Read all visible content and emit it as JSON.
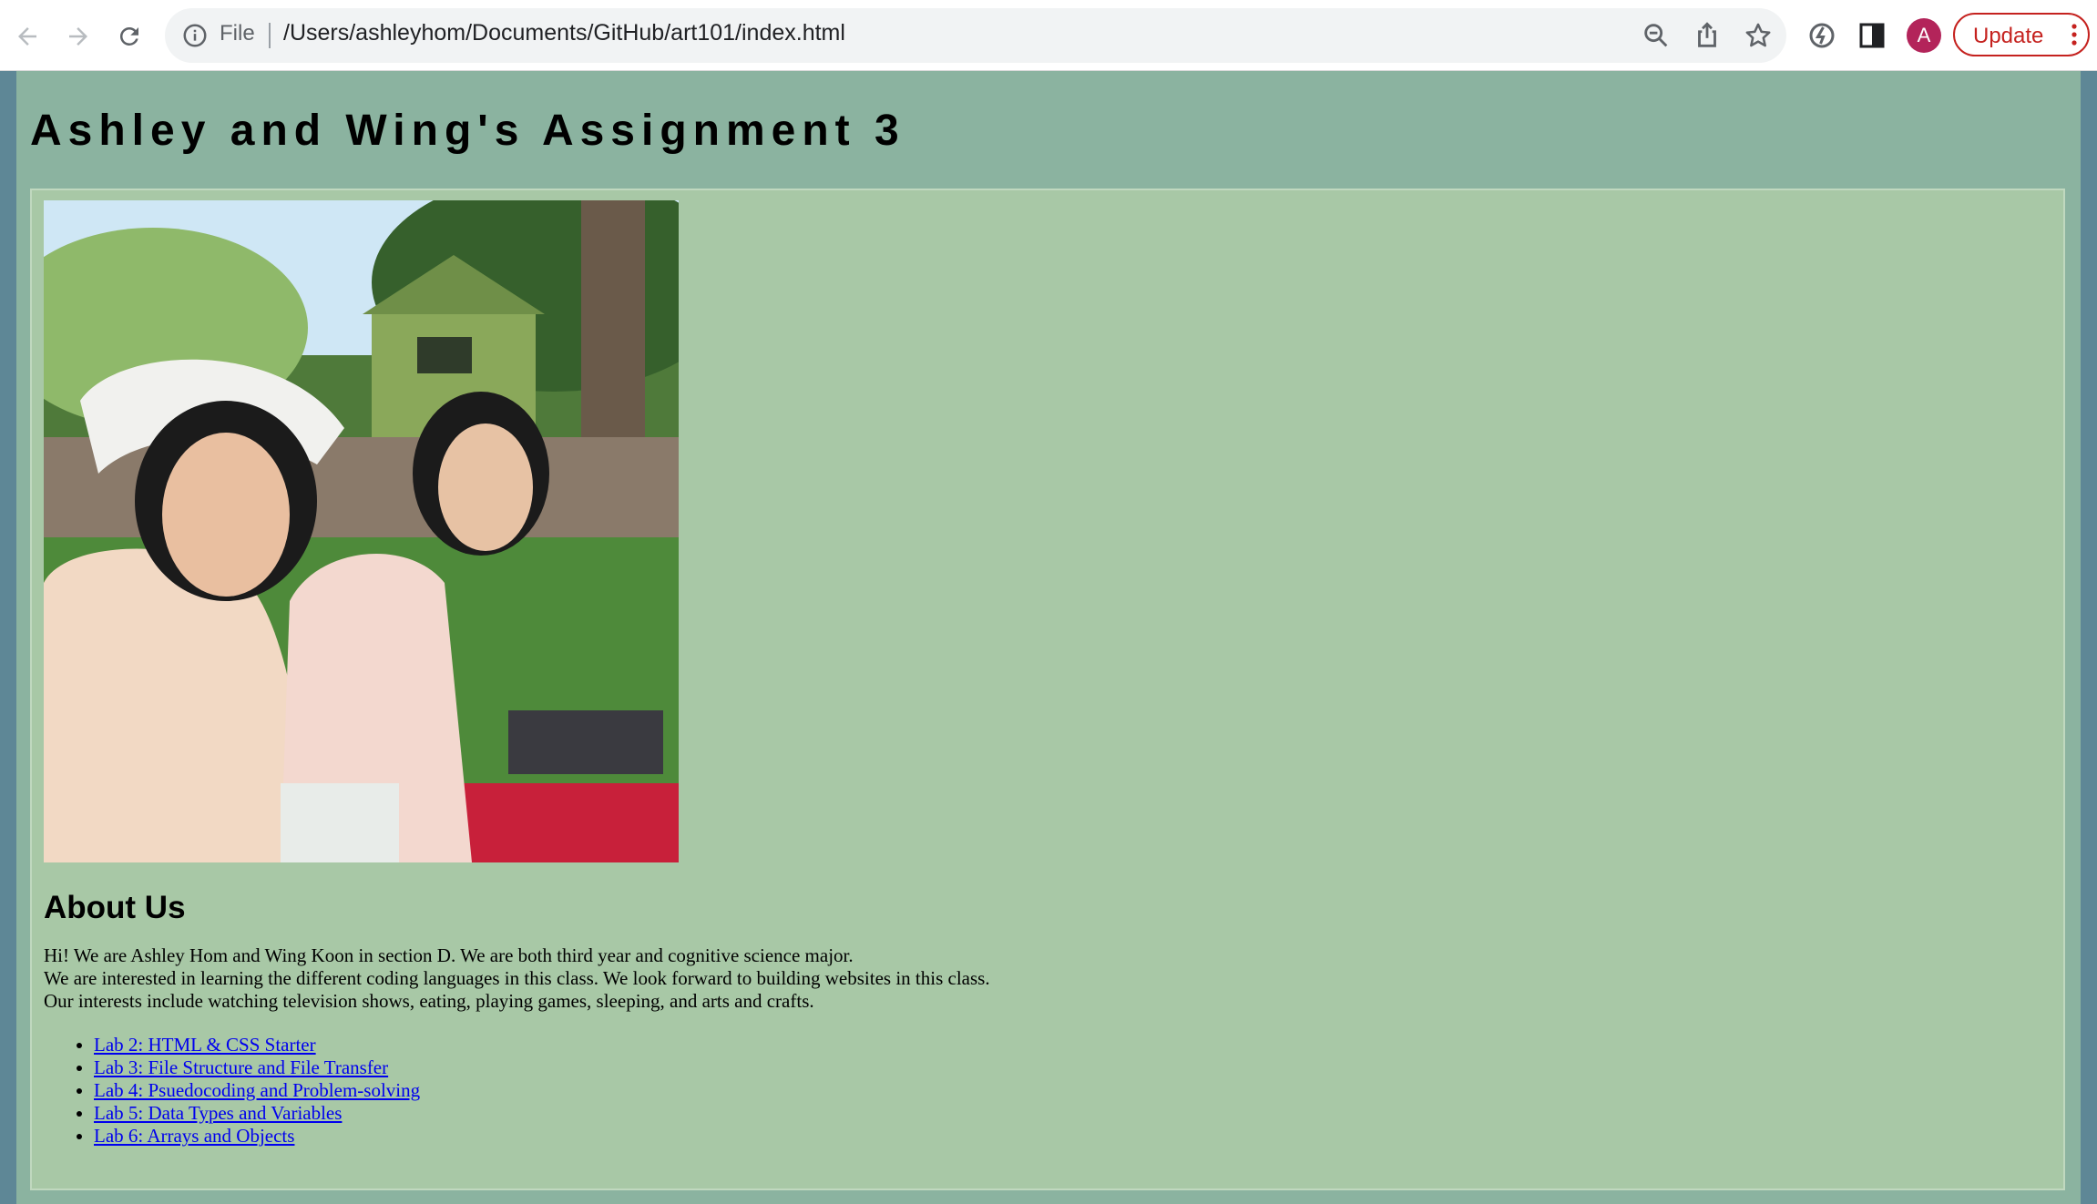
{
  "browser": {
    "url_scheme_label": "File",
    "url": "/Users/ashleyhom/Documents/GitHub/art101/index.html",
    "profile_initial": "A",
    "update_label": "Update",
    "icons": [
      "back-arrow-icon",
      "forward-arrow-icon",
      "reload-icon",
      "info-icon",
      "zoom-out-icon",
      "share-icon",
      "star-icon",
      "extensions-icon",
      "side-panel-icon",
      "more-vert-icon"
    ],
    "colors": {
      "update_accent": "#c5221f",
      "avatar": "#b3245a"
    }
  },
  "page": {
    "title": "Ashley and Wing's Assignment 3",
    "colors": {
      "outer": "#5e8796",
      "body": "#8bb3a0",
      "panel": "#a8c8a6",
      "link": "#0000ee"
    },
    "about": {
      "heading": "About Us",
      "lines": [
        "Hi! We are Ashley Hom and Wing Koon in section D. We are both third year and cognitive science major.",
        "We are interested in learning the different coding languages in this class. We look forward to building websites in this class.",
        "Our interests include watching television shows, eating, playing games, sleeping, and arts and crafts."
      ]
    },
    "labs": [
      "Lab 2: HTML & CSS Starter",
      "Lab 3: File Structure and File Transfer",
      "Lab 4: Psuedocoding and Problem-solving",
      "Lab 5: Data Types and Variables",
      "Lab 6: Arrays and Objects"
    ]
  }
}
